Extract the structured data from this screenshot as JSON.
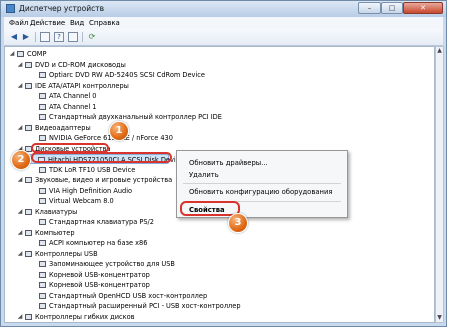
{
  "window": {
    "title": "Диспетчер устройств",
    "minimize": "–",
    "maximize": "□",
    "close": "✕"
  },
  "menu": {
    "items": [
      "Файл",
      "Действие",
      "Вид",
      "Справка"
    ]
  },
  "toolbar": {
    "icons": [
      "back-icon",
      "forward-icon",
      "properties-icon",
      "help-icon",
      "refresh-icon",
      "scan-icon"
    ]
  },
  "tree": {
    "rows": [
      {
        "label": "COMP",
        "expander": "◢"
      },
      {
        "label": "DVD и CD-ROM дисководы",
        "expander": "◢"
      },
      {
        "label": "Optiarc DVD RW AD-5240S SCSI CdRom Device",
        "expander": ""
      },
      {
        "label": "IDE ATA/ATAPI контроллеры",
        "expander": "◢"
      },
      {
        "label": "ATA Channel 0",
        "expander": ""
      },
      {
        "label": "ATA Channel 1",
        "expander": ""
      },
      {
        "label": "Стандартный двухканальный контроллер PCI IDE",
        "expander": ""
      },
      {
        "label": "Видеоадаптеры",
        "expander": "◢"
      },
      {
        "label": "NVIDIA GeForce 6150 LE / nForce 430",
        "expander": ""
      },
      {
        "label": "Дисковые устройства",
        "expander": "◢"
      },
      {
        "label": "Hitachi HDS721050CLA SCSI Disk Device",
        "expander": ""
      },
      {
        "label": "TDK LoR TF10 USB Device",
        "expander": ""
      },
      {
        "label": "Звуковые, видео и игровые устройства",
        "expander": "◢"
      },
      {
        "label": "VIA High Definition Audio",
        "expander": ""
      },
      {
        "label": "Virtual Webcam 8.0",
        "expander": ""
      },
      {
        "label": "Клавиатуры",
        "expander": "◢"
      },
      {
        "label": "Стандартная клавиатура PS/2",
        "expander": ""
      },
      {
        "label": "Компьютер",
        "expander": "◢"
      },
      {
        "label": "ACPI компьютер на базе x86",
        "expander": ""
      },
      {
        "label": "Контроллеры USB",
        "expander": "◢"
      },
      {
        "label": "Запоминающее устройство для USB",
        "expander": ""
      },
      {
        "label": "Корневой USB-концентратор",
        "expander": ""
      },
      {
        "label": "Корневой USB-концентратор",
        "expander": ""
      },
      {
        "label": "Стандартный OpenHCD USB хост-контроллер",
        "expander": ""
      },
      {
        "label": "Стандартный расширенный PCI - USB хост-контроллер",
        "expander": ""
      },
      {
        "label": "Контроллеры гибких дисков",
        "expander": "◢"
      }
    ]
  },
  "context_menu": {
    "update_drivers": "Обновить драйверы...",
    "delete": "Удалить",
    "scan_hardware": "Обновить конфигурацию оборудования",
    "properties": "Свойства"
  },
  "badges": [
    "1",
    "2",
    "3"
  ],
  "scrollbar": {
    "up": "▲",
    "down": "▼"
  },
  "colors": {
    "highlight_red": "#d8342d",
    "badge_orange": "#e06a15",
    "selection": "#cfe3f7"
  }
}
